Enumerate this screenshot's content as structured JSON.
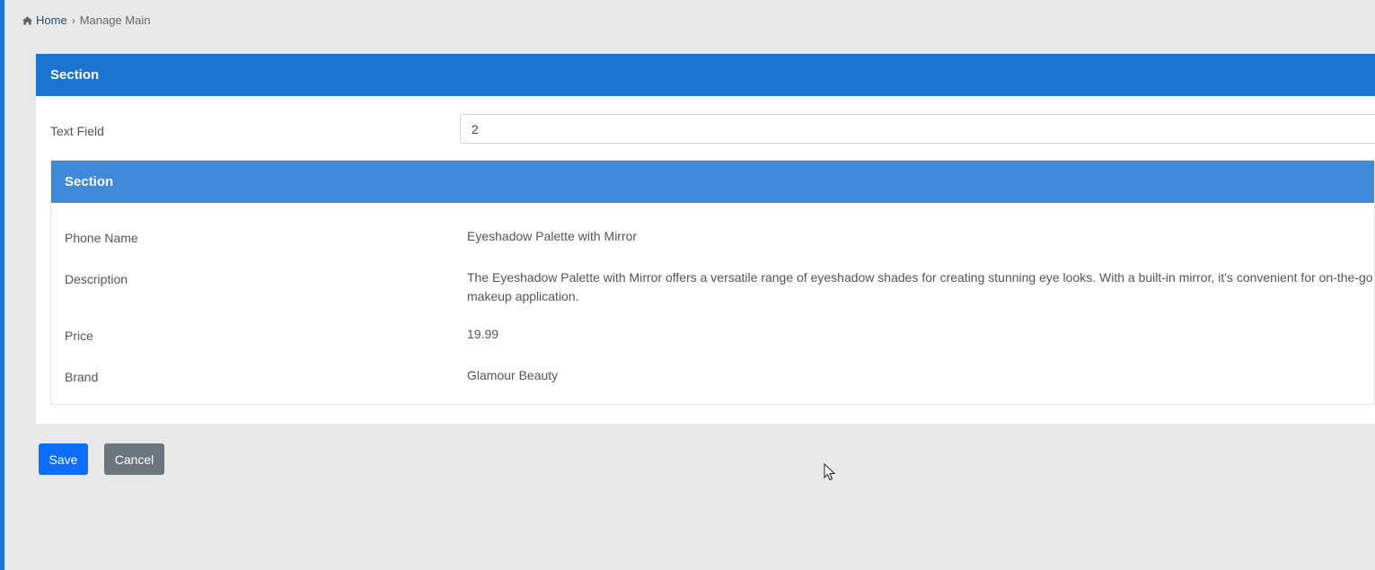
{
  "breadcrumb": {
    "home_label": "Home",
    "separator": "›",
    "current_label": "Manage Main"
  },
  "outer_section": {
    "title": "Section",
    "text_field": {
      "label": "Text Field",
      "value": "2"
    }
  },
  "inner_section": {
    "title": "Section",
    "rows": [
      {
        "label": "Phone Name",
        "value": "Eyeshadow Palette with Mirror"
      },
      {
        "label": "Description",
        "value": "The Eyeshadow Palette with Mirror offers a versatile range of eyeshadow shades for creating stunning eye looks. With a built-in mirror, it's convenient for on-the-go makeup application."
      },
      {
        "label": "Price",
        "value": "19.99"
      },
      {
        "label": "Brand",
        "value": "Glamour Beauty"
      }
    ]
  },
  "actions": {
    "save_label": "Save",
    "cancel_label": "Cancel"
  },
  "colors": {
    "primary_header": "#1c74d2",
    "secondary_header": "#3e8ad9",
    "save_button": "#0d6efd",
    "cancel_button": "#6c757d",
    "background": "#e8e8e8"
  },
  "icons": {
    "home": "home-icon",
    "cursor": "mouse-cursor-icon"
  }
}
